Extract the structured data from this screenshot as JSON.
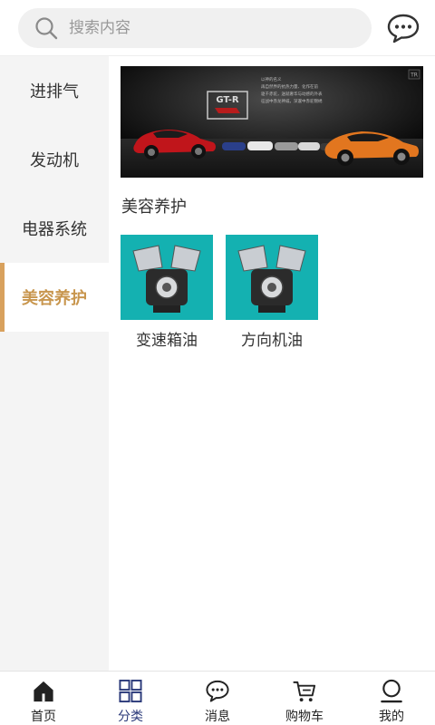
{
  "header": {
    "search_placeholder": "搜索内容",
    "search_icon": "search-icon",
    "message_icon": "chat-bubble-icon"
  },
  "sidebar": {
    "items": [
      {
        "label": "进排气",
        "active": false
      },
      {
        "label": "发动机",
        "active": false
      },
      {
        "label": "电器系统",
        "active": false
      },
      {
        "label": "美容养护",
        "active": true
      }
    ]
  },
  "main": {
    "banner": {
      "logo_text": "GT-R",
      "corner_badge": "TR",
      "caption_lines": [
        "以神的名义",
        "再自然界的抗热力量、化作在前",
        "驱千赤驼，送就奢华与动感的外表",
        "征战中赤龙神威，深邃中赤驼锦绣"
      ]
    },
    "section_title": "美容养护",
    "products": [
      {
        "name": "变速箱油"
      },
      {
        "name": "方向机油"
      }
    ]
  },
  "tabbar": {
    "items": [
      {
        "label": "首页",
        "icon": "home-icon"
      },
      {
        "label": "分类",
        "icon": "category-grid-icon",
        "active": true
      },
      {
        "label": "消息",
        "icon": "chat-bubble-icon"
      },
      {
        "label": "购物车",
        "icon": "cart-icon"
      },
      {
        "label": "我的",
        "icon": "user-icon"
      }
    ]
  },
  "colors": {
    "accent": "#d8a15d",
    "active_text": "#c8964e",
    "tab_active": "#2b3a7a",
    "product_bg": "#14b1b1",
    "sidebar_bg": "#f4f4f4"
  }
}
